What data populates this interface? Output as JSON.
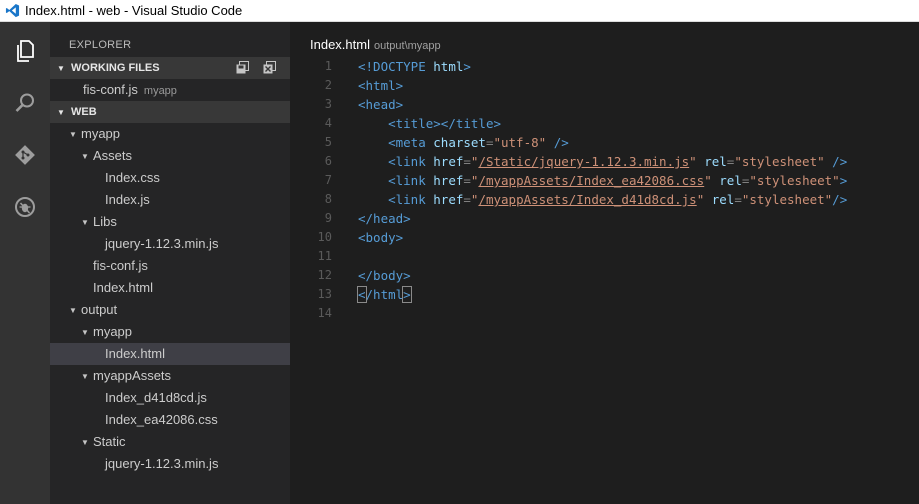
{
  "window": {
    "title": "Index.html - web - Visual Studio Code"
  },
  "activity_bar": [
    {
      "name": "explorer-icon"
    },
    {
      "name": "search-icon"
    },
    {
      "name": "git-icon"
    },
    {
      "name": "debug-icon"
    }
  ],
  "sidebar": {
    "title": "EXPLORER",
    "working_files": {
      "header": "WORKING FILES",
      "items": [
        {
          "label": "fis-conf.js",
          "hint": "myapp"
        }
      ]
    },
    "web": {
      "header": "WEB",
      "tree": [
        {
          "label": "myapp",
          "depth": 0,
          "folder": true
        },
        {
          "label": "Assets",
          "depth": 1,
          "folder": true
        },
        {
          "label": "Index.css",
          "depth": 2
        },
        {
          "label": "Index.js",
          "depth": 2
        },
        {
          "label": "Libs",
          "depth": 1,
          "folder": true
        },
        {
          "label": "jquery-1.12.3.min.js",
          "depth": 2
        },
        {
          "label": "fis-conf.js",
          "depth": 1
        },
        {
          "label": "Index.html",
          "depth": 1
        },
        {
          "label": "output",
          "depth": 0,
          "folder": true
        },
        {
          "label": "myapp",
          "depth": 1,
          "folder": true
        },
        {
          "label": "Index.html",
          "depth": 2,
          "selected": true
        },
        {
          "label": "myappAssets",
          "depth": 1,
          "folder": true
        },
        {
          "label": "Index_d41d8cd.js",
          "depth": 2
        },
        {
          "label": "Index_ea42086.css",
          "depth": 2
        },
        {
          "label": "Static",
          "depth": 1,
          "folder": true
        },
        {
          "label": "jquery-1.12.3.min.js",
          "depth": 2
        }
      ]
    }
  },
  "editor": {
    "tab": {
      "title": "Index.html",
      "path": "output\\myapp"
    },
    "lines": [
      {
        "n": "1",
        "indent": "",
        "tokens": [
          [
            "tag",
            "<!DOCTYPE "
          ],
          [
            "attr",
            "html"
          ],
          [
            "tag",
            ">"
          ]
        ]
      },
      {
        "n": "2",
        "indent": "",
        "tokens": [
          [
            "tag",
            "<html>"
          ]
        ]
      },
      {
        "n": "3",
        "indent": "",
        "tokens": [
          [
            "tag",
            "<head>"
          ]
        ]
      },
      {
        "n": "4",
        "indent": "    ",
        "tokens": [
          [
            "tag",
            "<title></title>"
          ]
        ]
      },
      {
        "n": "5",
        "indent": "    ",
        "tokens": [
          [
            "tag",
            "<meta "
          ],
          [
            "attr",
            "charset"
          ],
          [
            "punct",
            "="
          ],
          [
            "str",
            "\"utf-8\""
          ],
          [
            "tag",
            " />"
          ]
        ]
      },
      {
        "n": "6",
        "indent": "    ",
        "tokens": [
          [
            "tag",
            "<link "
          ],
          [
            "attr",
            "href"
          ],
          [
            "punct",
            "="
          ],
          [
            "str",
            "\""
          ],
          [
            "str link",
            "/Static/jquery-1.12.3.min.js"
          ],
          [
            "str",
            "\""
          ],
          [
            "plain",
            " "
          ],
          [
            "attr",
            "rel"
          ],
          [
            "punct",
            "="
          ],
          [
            "str",
            "\"stylesheet\""
          ],
          [
            "tag",
            " />"
          ]
        ]
      },
      {
        "n": "7",
        "indent": "    ",
        "tokens": [
          [
            "tag",
            "<link "
          ],
          [
            "attr",
            "href"
          ],
          [
            "punct",
            "="
          ],
          [
            "str",
            "\""
          ],
          [
            "str link",
            "/myappAssets/Index_ea42086.css"
          ],
          [
            "str",
            "\""
          ],
          [
            "plain",
            " "
          ],
          [
            "attr",
            "rel"
          ],
          [
            "punct",
            "="
          ],
          [
            "str",
            "\"stylesheet\""
          ],
          [
            "tag",
            ">"
          ]
        ]
      },
      {
        "n": "8",
        "indent": "    ",
        "tokens": [
          [
            "tag",
            "<link "
          ],
          [
            "attr",
            "href"
          ],
          [
            "punct",
            "="
          ],
          [
            "str",
            "\""
          ],
          [
            "str link",
            "/myappAssets/Index_d41d8cd.js"
          ],
          [
            "str",
            "\""
          ],
          [
            "plain",
            " "
          ],
          [
            "attr",
            "rel"
          ],
          [
            "punct",
            "="
          ],
          [
            "str",
            "\"stylesheet\""
          ],
          [
            "tag",
            "/>"
          ]
        ]
      },
      {
        "n": "9",
        "indent": "",
        "tokens": [
          [
            "tag",
            "</head>"
          ]
        ]
      },
      {
        "n": "10",
        "indent": "",
        "tokens": [
          [
            "tag",
            "<body>"
          ]
        ]
      },
      {
        "n": "11",
        "indent": "",
        "tokens": []
      },
      {
        "n": "12",
        "indent": "",
        "tokens": [
          [
            "tag",
            "</body>"
          ]
        ]
      },
      {
        "n": "13",
        "indent": "",
        "tokens": [
          [
            "tag bm",
            "<"
          ],
          [
            "tag",
            "/html"
          ],
          [
            "tag bm",
            ">"
          ],
          [
            "cursor",
            ""
          ]
        ]
      },
      {
        "n": "14",
        "indent": "",
        "tokens": []
      }
    ]
  },
  "colors": {
    "tag": "#569cd6",
    "attribute": "#9cdcfe",
    "string": "#ce9178",
    "editor_bg": "#1e1e1e",
    "sidebar_bg": "#252526",
    "activity_bg": "#333333"
  }
}
